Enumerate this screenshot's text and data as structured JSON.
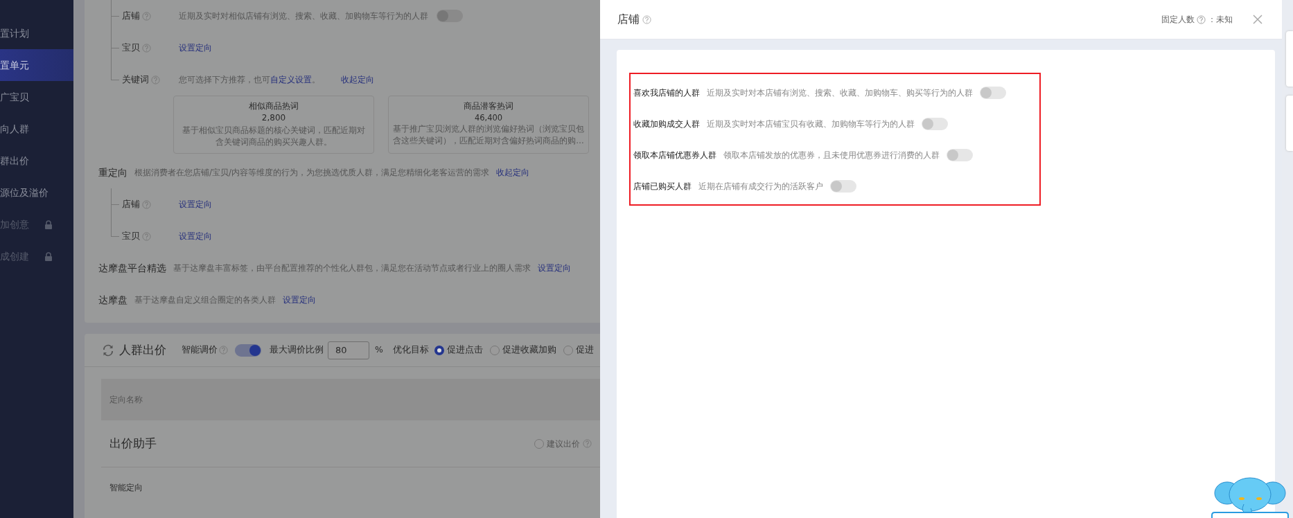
{
  "sidebar": {
    "items": [
      {
        "label": "置计划",
        "selected": false,
        "locked": false
      },
      {
        "label": "置单元",
        "selected": true,
        "locked": false
      },
      {
        "label": "广宝贝",
        "selected": false,
        "locked": false
      },
      {
        "label": "向人群",
        "selected": false,
        "locked": false
      },
      {
        "label": "群出价",
        "selected": false,
        "locked": false
      },
      {
        "label": "源位及溢价",
        "selected": false,
        "locked": false
      },
      {
        "label": "加创意",
        "selected": false,
        "locked": true
      },
      {
        "label": "成创建",
        "selected": false,
        "locked": true
      }
    ]
  },
  "similar_targeting": {
    "rows": [
      {
        "kind": "toggle",
        "label": "店铺",
        "description": "近期及实时对相似店铺有浏览、搜索、收藏、加购物车等行为的人群",
        "on": false
      },
      {
        "kind": "link",
        "label": "宝贝",
        "link": "设置定向"
      },
      {
        "kind": "keyword",
        "label": "关键词",
        "hint": "您可选择下方推荐，也可",
        "hint_link": "自定义设置",
        "hint_end": "。",
        "action": "收起定向"
      }
    ],
    "keyword_cards": [
      {
        "title": "相似商品热词",
        "count": "2,800",
        "description": "基于相似宝贝商品标题的核心关键词，匹配近期对含关键词商品的购买兴趣人群。"
      },
      {
        "title": "商品潜客热词",
        "count": "46,400",
        "description": "基于推广宝贝浏览人群的浏览偏好热词（浏览宝贝包含这些关键词），匹配近期对含偏好热词商品的购…"
      }
    ]
  },
  "retargeting": {
    "title": "重定向",
    "description": "根据消费者在您店铺/宝贝/内容等维度的行为，为您挑选优质人群，满足您精细化老客运营的需求",
    "action": "收起定向",
    "rows": [
      {
        "label": "店铺",
        "link": "设置定向"
      },
      {
        "label": "宝贝",
        "link": "设置定向"
      }
    ]
  },
  "dmp_sections": [
    {
      "title": "达摩盘平台精选",
      "description": "基于达摩盘丰富标签，由平台配置推荐的个性化人群包，满足您在活动节点或者行业上的圈人需求",
      "link": "设置定向"
    },
    {
      "title": "达摩盘",
      "description": "基于达摩盘自定义组合圈定的各类人群",
      "link": "设置定向"
    }
  ],
  "crowd_bid": {
    "title": "人群出价",
    "smart_label": "智能调价",
    "smart_on": true,
    "max_label": "最大调价比例",
    "max_value": "80",
    "unit": "%",
    "goal_label": "优化目标",
    "goals": [
      {
        "label": "促进点击",
        "selected": true
      },
      {
        "label": "促进收藏加购",
        "selected": false
      },
      {
        "label": "促进",
        "selected": false
      }
    ],
    "table": {
      "columns": [
        "定向名称"
      ],
      "helper": "出价助手",
      "suggest": {
        "label": "建议出价",
        "selected": false
      },
      "section": "智能定向"
    }
  },
  "drawer": {
    "title": "店铺",
    "fixed_label": "固定人数",
    "fixed_value": "：未知",
    "highlighted": true,
    "items": [
      {
        "label": "喜欢我店铺的人群",
        "description": "近期及实时对本店铺有浏览、搜索、收藏、加购物车、购买等行为的人群",
        "on": false
      },
      {
        "label": "收藏加购成交人群",
        "description": "近期及实时对本店铺宝贝有收藏、加购物车等行为的人群",
        "on": false
      },
      {
        "label": "领取本店铺优惠券人群",
        "description": "领取本店铺发放的优惠券，且未使用优惠券进行消费的人群",
        "on": false
      },
      {
        "label": "店铺已购买人群",
        "description": "近期在店铺有成交行为的活跃客户",
        "on": false
      }
    ]
  }
}
